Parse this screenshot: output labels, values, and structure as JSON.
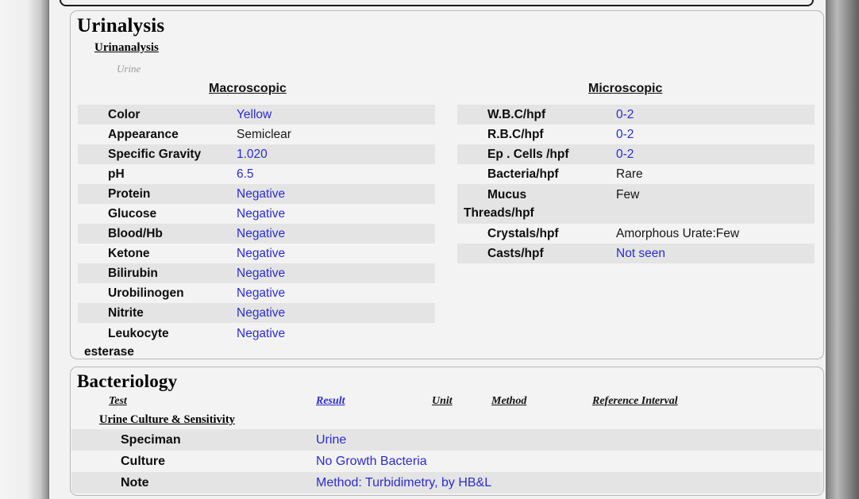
{
  "document": {
    "sections": [
      {
        "id": "urinalysis",
        "title": "Urinalysis",
        "panel_name": "Urinanalysis",
        "specimen": "Urine",
        "columns": [
          {
            "header": "Macroscopic"
          },
          {
            "header": "Microscopic"
          }
        ],
        "macroscopic": [
          {
            "label": "Color",
            "value": "Yellow",
            "value_color": "blue"
          },
          {
            "label": "Appearance",
            "value": "Semiclear",
            "value_color": "black"
          },
          {
            "label": "Specific Gravity",
            "value": "1.020",
            "value_color": "blue"
          },
          {
            "label": "pH",
            "value": "6.5",
            "value_color": "blue"
          },
          {
            "label": "Protein",
            "value": "Negative",
            "value_color": "blue"
          },
          {
            "label": "Glucose",
            "value": "Negative",
            "value_color": "blue"
          },
          {
            "label": "Blood/Hb",
            "value": "Negative",
            "value_color": "blue"
          },
          {
            "label": "Ketone",
            "value": "Negative",
            "value_color": "blue"
          },
          {
            "label": "Bilirubin",
            "value": "Negative",
            "value_color": "blue"
          },
          {
            "label": "Urobilinogen",
            "value": "Negative",
            "value_color": "blue"
          },
          {
            "label": "Nitrite",
            "value": "Negative",
            "value_color": "blue"
          },
          {
            "label": "Leukocyte",
            "label_line2": "esterase",
            "value": "Negative",
            "value_color": "blue"
          }
        ],
        "microscopic": [
          {
            "label": "W.B.C/hpf",
            "value": "0-2",
            "value_color": "blue"
          },
          {
            "label": "R.B.C/hpf",
            "value": "0-2",
            "value_color": "blue"
          },
          {
            "label": "Ep . Cells /hpf",
            "value": "0-2",
            "value_color": "blue"
          },
          {
            "label": "Bacteria/hpf",
            "value": "Rare",
            "value_color": "black"
          },
          {
            "label": "Mucus",
            "label_line2": "Threads/hpf",
            "value": "Few",
            "value_color": "black"
          },
          {
            "label": "Crystals/hpf",
            "value": "Amorphous Urate:Few",
            "value_color": "black"
          },
          {
            "label": "Casts/hpf",
            "value": "Not seen",
            "value_color": "blue"
          }
        ]
      },
      {
        "id": "bacteriology",
        "title": "Bacteriology",
        "headers": {
          "test": "Test",
          "result": "Result",
          "unit": "Unit",
          "method": "Method",
          "reference_interval": "Reference Interval"
        },
        "panel_name": "Urine Culture & Sensitivity",
        "rows": [
          {
            "label": "Speciman",
            "value": "Urine",
            "value_color": "blue"
          },
          {
            "label": "Culture",
            "value": "No Growth Bacteria",
            "value_color": "blue"
          },
          {
            "label": "Note",
            "value": "Method:   Turbidimetry,    by HB&L",
            "value_color": "blue"
          }
        ]
      }
    ]
  },
  "colors": {
    "value_blue": "#2b2bd4",
    "value_black": "#161616",
    "row_shade": "#e4e4e4",
    "page": "#f2f2f2"
  }
}
